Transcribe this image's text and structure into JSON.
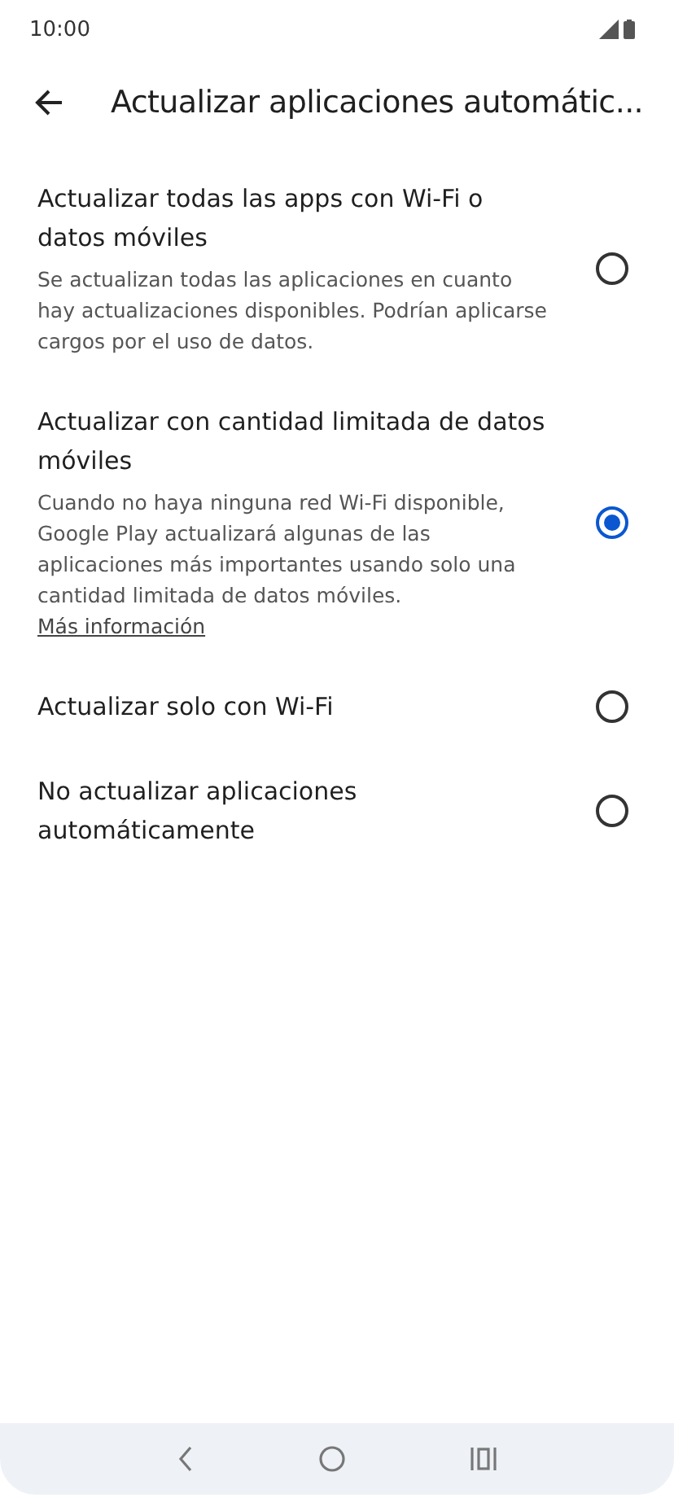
{
  "status_bar": {
    "time": "10:00"
  },
  "header": {
    "title": "Actualizar aplicaciones automátic..."
  },
  "options": [
    {
      "title": "Actualizar todas las apps con Wi-Fi o datos móviles",
      "description": "Se actualizan todas las aplicaciones en cuanto hay actualizaciones disponibles. Podrían aplicarse cargos por el uso de datos.",
      "selected": false
    },
    {
      "title": "Actualizar con cantidad limitada de datos móviles",
      "description": "Cuando no haya ninguna red Wi-Fi disponible, Google Play actualizará algunas de las aplicaciones más importantes usando solo una cantidad limitada de datos móviles.",
      "link": "Más información",
      "selected": true
    },
    {
      "title": "Actualizar solo con Wi-Fi",
      "selected": false
    },
    {
      "title": "No actualizar aplicaciones automáticamente",
      "selected": false
    }
  ]
}
